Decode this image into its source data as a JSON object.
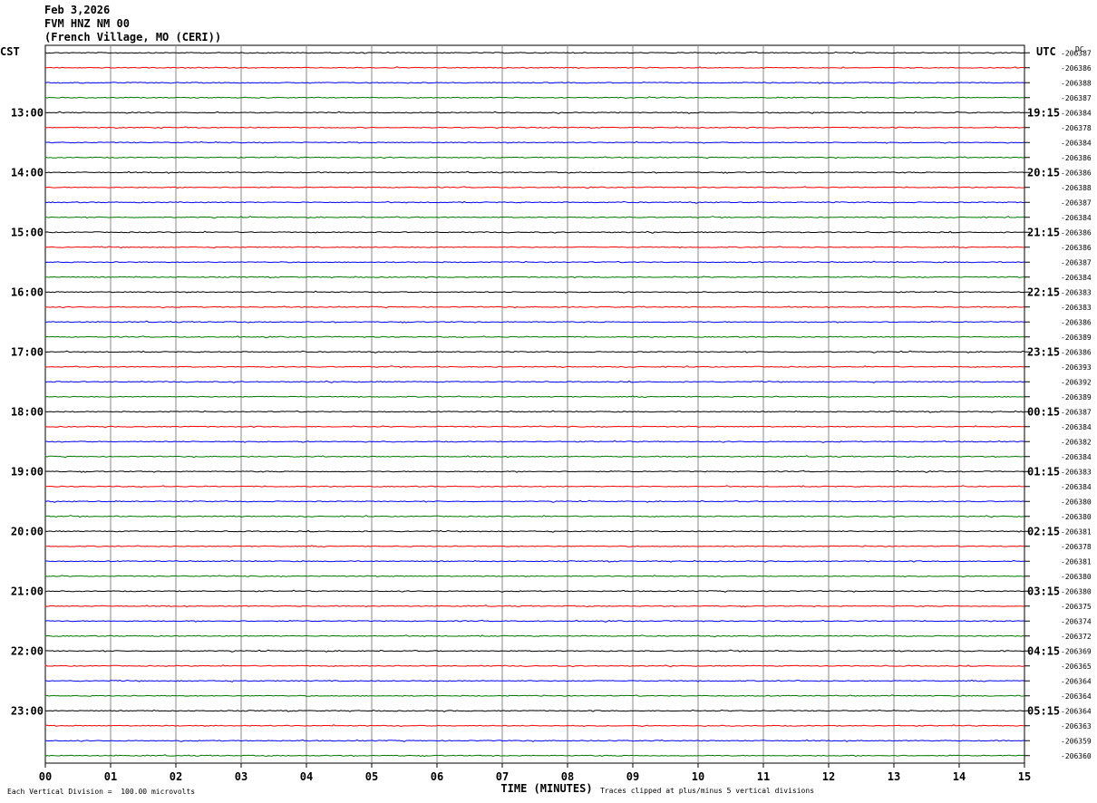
{
  "header": {
    "date": "Feb 3,2026",
    "station": "FVM HNZ NM 00",
    "location": "(French Village, MO (CERI))"
  },
  "chart_data": {
    "type": "line",
    "subtype": "helicorder",
    "left_timezone": "CST",
    "right_timezone": "UTC",
    "dc_label": "DC",
    "xlabel": "TIME (MINUTES)",
    "x_ticks": [
      "00",
      "01",
      "02",
      "03",
      "04",
      "05",
      "06",
      "07",
      "08",
      "09",
      "10",
      "11",
      "12",
      "13",
      "14",
      "15"
    ],
    "xlim": [
      0,
      15
    ],
    "minutes_per_line": 15,
    "trace_colors": [
      "#000000",
      "#ff0000",
      "#0000ff",
      "#007700"
    ],
    "grid": true,
    "left_hour_labels": [
      "13:00",
      "14:00",
      "15:00",
      "16:00",
      "17:00",
      "18:00",
      "19:00",
      "20:00",
      "21:00",
      "22:00",
      "23:00"
    ],
    "right_hour_labels": [
      "19:15",
      "20:15",
      "21:15",
      "22:15",
      "23:15",
      "00:15",
      "01:15",
      "02:15",
      "03:15",
      "04:15",
      "05:15"
    ],
    "dc_offsets": [
      "-206387",
      "-206386",
      "-206388",
      "-206387",
      "-206384",
      "-206378",
      "-206384",
      "-206386",
      "-206386",
      "-206388",
      "-206387",
      "-206384",
      "-206386",
      "-206386",
      "-206387",
      "-206384",
      "-206383",
      "-206383",
      "-206386",
      "-206389",
      "-206386",
      "-206393",
      "-206392",
      "-206389",
      "-206387",
      "-206384",
      "-206382",
      "-206384",
      "-206383",
      "-206384",
      "-206380",
      "-206380",
      "-206381",
      "-206378",
      "-206381",
      "-206380",
      "-206380",
      "-206375",
      "-206374",
      "-206372",
      "-206369",
      "-206365",
      "-206364",
      "-206364",
      "-206364",
      "-206363",
      "-206359",
      "-206360"
    ]
  },
  "footer": {
    "scale_note": "Each Vertical Division =  100.00 microvolts",
    "clip_note": "Traces clipped at plus/minus 5 vertical divisions"
  }
}
